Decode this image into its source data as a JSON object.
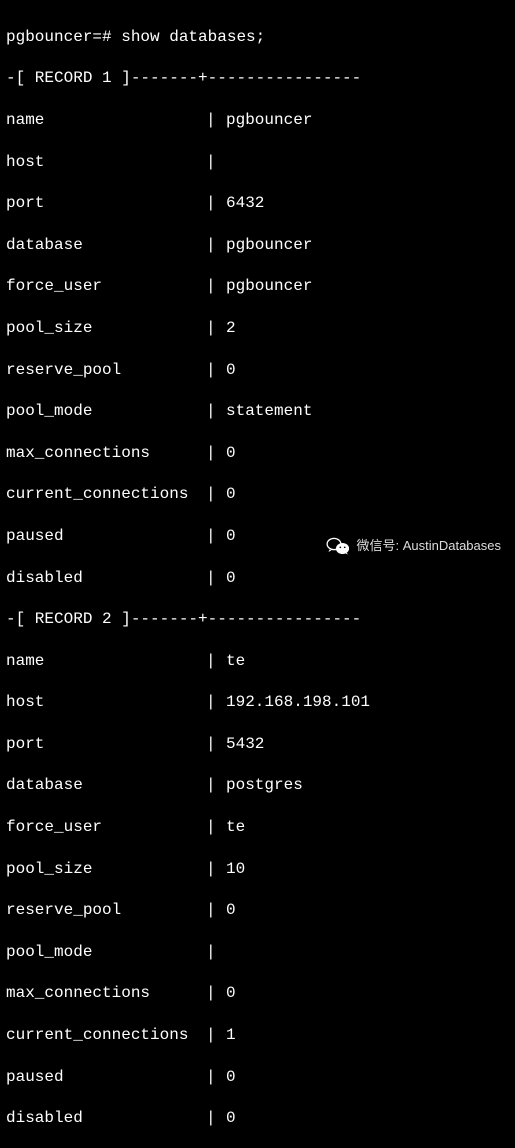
{
  "prompt": "pgbouncer=# show databases;",
  "record1_header": "-[ RECORD 1 ]-------+----------------",
  "record2_header": "-[ RECORD 2 ]-------+----------------",
  "separator": "|",
  "fields": {
    "name": "name",
    "host": "host",
    "port": "port",
    "database": "database",
    "force_user": "force_user",
    "pool_size": "pool_size",
    "reserve_pool": "reserve_pool",
    "pool_mode": "pool_mode",
    "max_connections": "max_connections",
    "current_connections": "current_connections",
    "paused": "paused",
    "disabled": "disabled"
  },
  "record1": {
    "name": "pgbouncer",
    "host": "",
    "port": "6432",
    "database": "pgbouncer",
    "force_user": "pgbouncer",
    "pool_size": "2",
    "reserve_pool": "0",
    "pool_mode": "statement",
    "max_connections": "0",
    "current_connections": "0",
    "paused": "0",
    "disabled": "0"
  },
  "record2": {
    "name": "te",
    "host": "192.168.198.101",
    "port": "5432",
    "database": "postgres",
    "force_user": "te",
    "pool_size": "10",
    "reserve_pool": "0",
    "pool_mode": "",
    "max_connections": "0",
    "current_connections": "1",
    "paused": "0",
    "disabled": "0"
  },
  "watermark": {
    "label": "微信号",
    "colon": ":",
    "value": "AustinDatabases"
  }
}
